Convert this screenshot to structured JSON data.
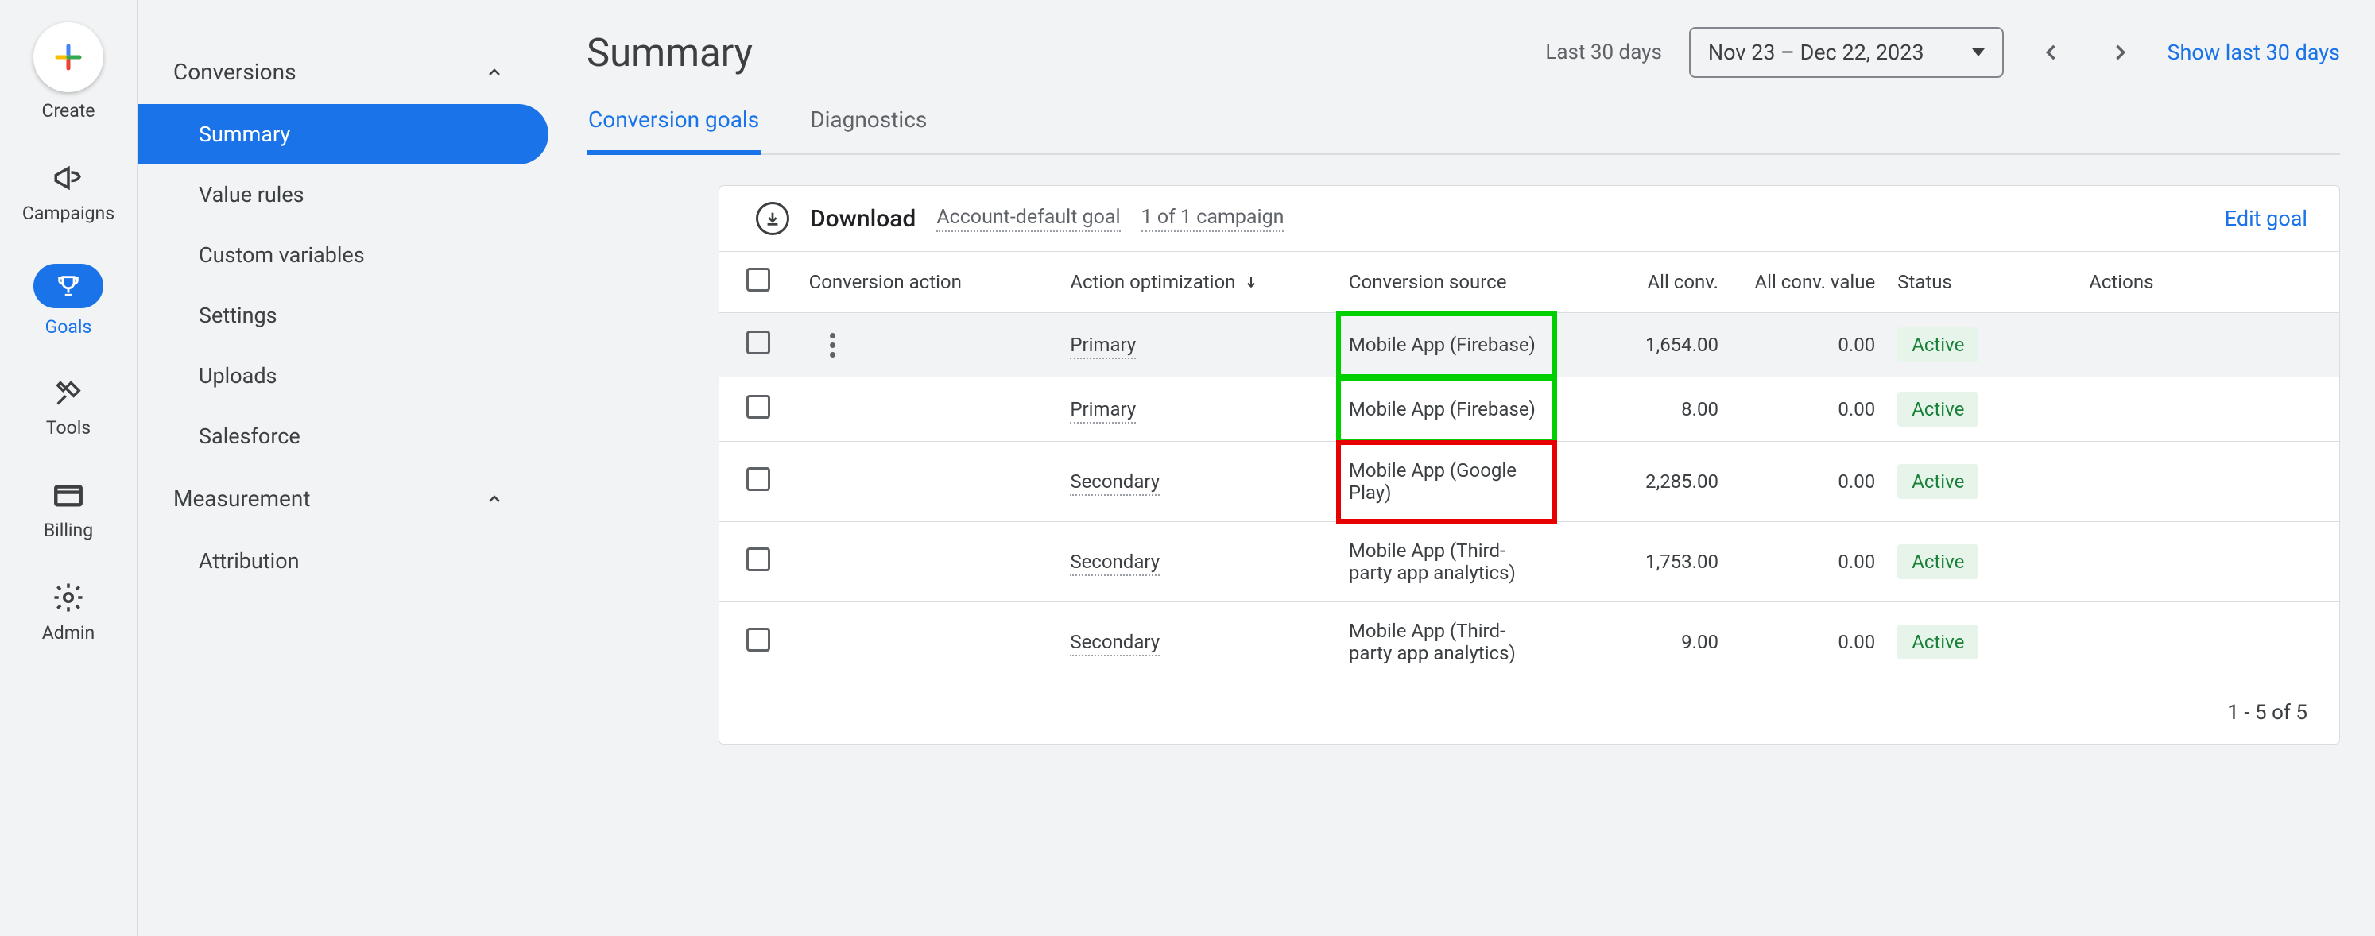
{
  "rail": {
    "create": "Create",
    "items": [
      {
        "label": "Campaigns",
        "icon": "megaphone"
      },
      {
        "label": "Goals",
        "icon": "trophy",
        "active": true
      },
      {
        "label": "Tools",
        "icon": "tools"
      },
      {
        "label": "Billing",
        "icon": "card"
      },
      {
        "label": "Admin",
        "icon": "gear"
      }
    ]
  },
  "sidebar": {
    "group1": {
      "title": "Conversions",
      "items": [
        "Summary",
        "Value rules",
        "Custom variables",
        "Settings",
        "Uploads",
        "Salesforce"
      ],
      "active_index": 0
    },
    "group2": {
      "title": "Measurement",
      "items": [
        "Attribution"
      ]
    }
  },
  "header": {
    "title": "Summary",
    "date_label": "Last 30 days",
    "date_range": "Nov 23 – Dec 22, 2023",
    "show_link": "Show last 30 days"
  },
  "tabs": [
    {
      "label": "Conversion goals",
      "active": true
    },
    {
      "label": "Diagnostics"
    }
  ],
  "card": {
    "title": "Download",
    "meta1": "Account-default goal",
    "meta2": "1 of 1 campaign",
    "edit": "Edit goal",
    "columns": {
      "action": "Conversion action",
      "opt": "Action optimization",
      "src": "Conversion source",
      "allconv": "All conv.",
      "allval": "All conv. value",
      "status": "Status",
      "actions": "Actions"
    },
    "rows": [
      {
        "opt": "Primary",
        "src": "Mobile App (Firebase)",
        "allconv": "1,654.00",
        "allval": "0.00",
        "status": "Active",
        "hover": true,
        "hl": "green"
      },
      {
        "opt": "Primary",
        "src": "Mobile App (Firebase)",
        "allconv": "8.00",
        "allval": "0.00",
        "status": "Active",
        "hl": "green"
      },
      {
        "opt": "Secondary",
        "src": "Mobile App (Google Play)",
        "allconv": "2,285.00",
        "allval": "0.00",
        "status": "Active",
        "hl": "red"
      },
      {
        "opt": "Secondary",
        "src": "Mobile App (Third-party app analytics)",
        "allconv": "1,753.00",
        "allval": "0.00",
        "status": "Active"
      },
      {
        "opt": "Secondary",
        "src": "Mobile App (Third-party app analytics)",
        "allconv": "9.00",
        "allval": "0.00",
        "status": "Active"
      }
    ],
    "pager": "1 - 5 of 5"
  }
}
